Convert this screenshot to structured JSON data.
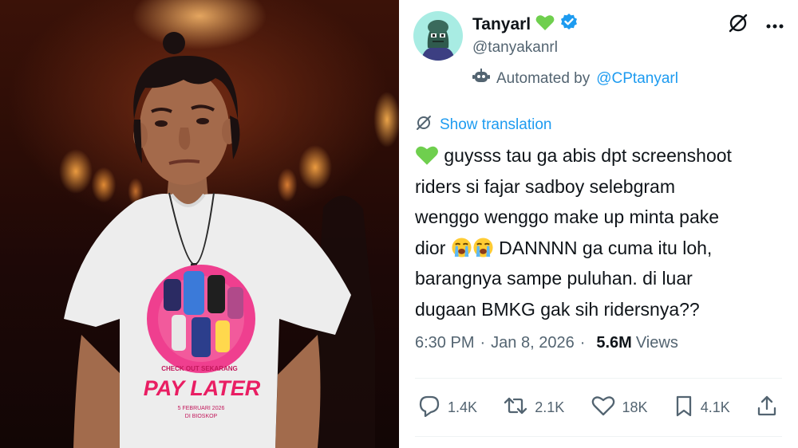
{
  "author": {
    "display_name": "Tanyarl",
    "handle": "@tanyakanrl",
    "verified": true,
    "name_emoji": "green-heart",
    "automated_label": "Automated by",
    "automated_account": "@CPtanyarl"
  },
  "translation": {
    "label": "Show translation"
  },
  "tweet": {
    "line1": "guysss tau ga abis dpt screenshoot",
    "line2": "riders si fajar sadboy selebgram",
    "line3": "wenggo wenggo make up minta pake",
    "line4_start": "dior",
    "line4_end": "DANNNN ga cuma itu loh,",
    "line5": "barangnya sampe puluhan. di luar",
    "line6": "dugaan BMKG gak sih ridersnya??",
    "emojis": [
      "green-heart",
      "loudly-crying-face",
      "loudly-crying-face"
    ]
  },
  "meta": {
    "time": "6:30 PM",
    "separator": "·",
    "date": "Jan 8, 2026",
    "views_count": "5.6M",
    "views_label": "Views"
  },
  "actions": {
    "replies": "1.4K",
    "reposts": "2.1K",
    "likes": "18K",
    "bookmarks": "4.1K"
  },
  "photo": {
    "shirt_heading": "CHECK OUT SEKARANG",
    "shirt_title": "PAY LATER",
    "shirt_date": "5 FEBRUARI 2026",
    "shirt_venue": "DI BIOSKOP"
  },
  "colors": {
    "accent": "#1d9bf0",
    "text_primary": "#0f1419",
    "text_secondary": "#536471",
    "heart_green": "#6fcf4e",
    "avatar_bg": "#a8ece3",
    "verified_blue": "#1d9bf0",
    "shirt_pink": "#ef3f8f"
  }
}
